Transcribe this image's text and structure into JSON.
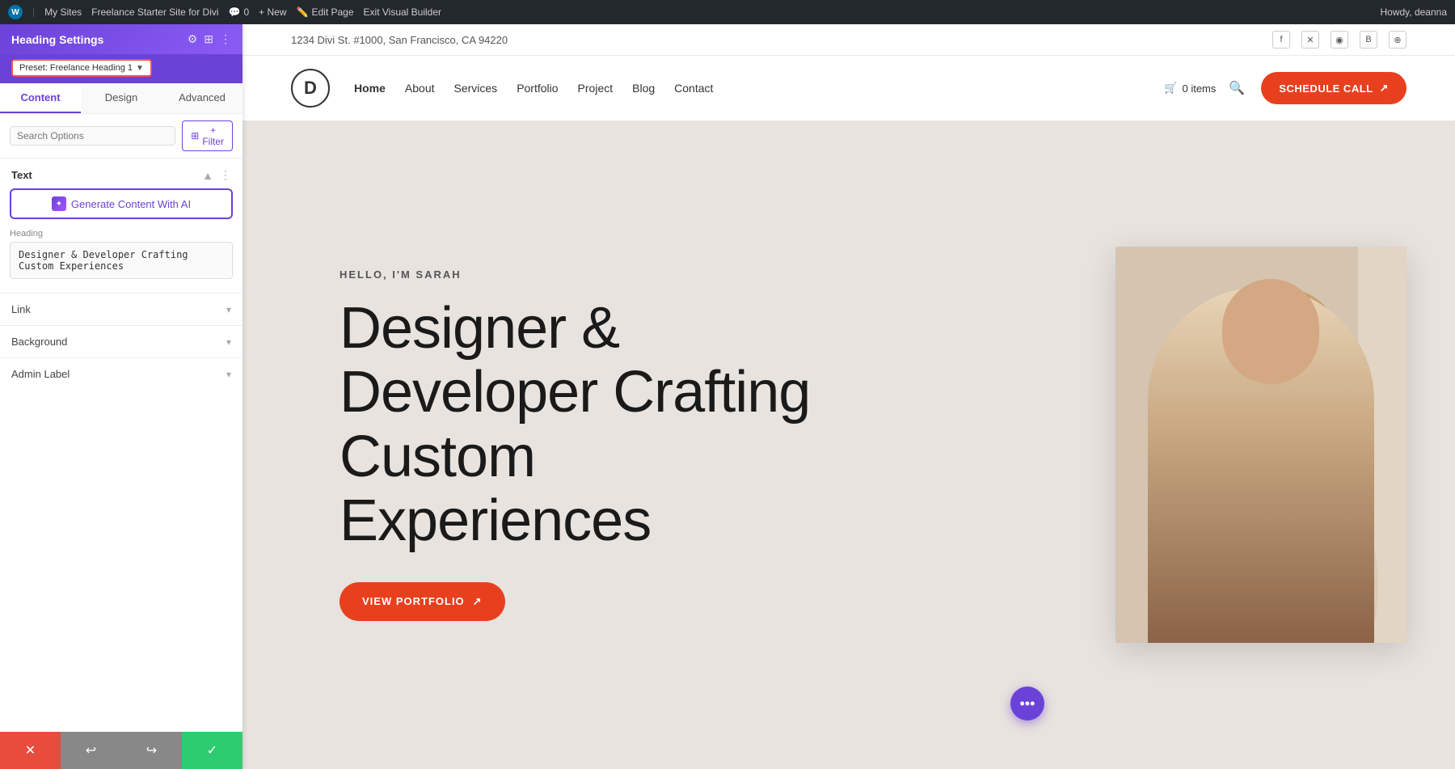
{
  "admin_bar": {
    "wp_label": "W",
    "my_sites": "My Sites",
    "starter_site": "Freelance Starter Site for Divi",
    "comments": "0",
    "new": "+ New",
    "edit_page": "Edit Page",
    "exit_builder": "Exit Visual Builder",
    "howdy": "Howdy, deanna"
  },
  "sidebar": {
    "title": "Heading Settings",
    "preset_label": "Preset: Freelance Heading 1",
    "tabs": [
      {
        "id": "content",
        "label": "Content",
        "active": true
      },
      {
        "id": "design",
        "label": "Design",
        "active": false
      },
      {
        "id": "advanced",
        "label": "Advanced",
        "active": false
      }
    ],
    "search_placeholder": "Search Options",
    "filter_label": "+ Filter",
    "text_section": {
      "title": "Text",
      "ai_btn": "Generate Content With AI",
      "heading_label": "Heading",
      "heading_value": "Designer & Developer Crafting Custom Experiences"
    },
    "link_section": "Link",
    "background_section": "Background",
    "admin_label_section": "Admin Label"
  },
  "toolbar": {
    "cancel_icon": "✕",
    "undo_icon": "↩",
    "redo_icon": "↪",
    "confirm_icon": "✓"
  },
  "site": {
    "topbar": {
      "address": "1234 Divi St. #1000, San Francisco, CA 94220"
    },
    "nav": {
      "logo": "D",
      "links": [
        {
          "label": "Home",
          "active": true
        },
        {
          "label": "About",
          "active": false
        },
        {
          "label": "Services",
          "active": false
        },
        {
          "label": "Portfolio",
          "active": false
        },
        {
          "label": "Project",
          "active": false
        },
        {
          "label": "Blog",
          "active": false
        },
        {
          "label": "Contact",
          "active": false
        }
      ],
      "cart_label": "0 items",
      "schedule_btn": "SCHEDULE CALL",
      "schedule_icon": "↗"
    },
    "hero": {
      "subtitle": "HELLO, I'M SARAH",
      "title": "Designer & Developer Crafting Custom Experiences",
      "cta_label": "VIEW PORTFOLIO",
      "cta_icon": "↗"
    },
    "social": {
      "icons": [
        "f",
        "𝕏",
        "📷",
        "B",
        "⊕"
      ]
    }
  },
  "colors": {
    "purple": "#6b42d8",
    "orange_cta": "#e8401e",
    "bg_beige": "#e8e3de",
    "text_dark": "#1a1a1a"
  }
}
